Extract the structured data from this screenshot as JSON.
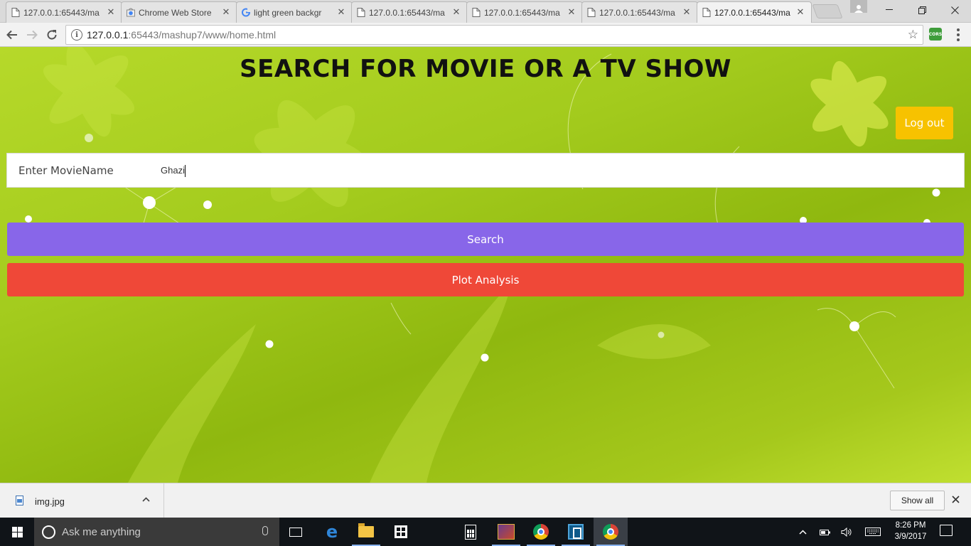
{
  "browser": {
    "tabs": [
      {
        "title": "127.0.0.1:65443/ma",
        "icon": "document-icon",
        "active": false
      },
      {
        "title": "Chrome Web Store",
        "icon": "chrome-web-store-icon",
        "active": false
      },
      {
        "title": "light green backgr",
        "icon": "google-icon",
        "active": false
      },
      {
        "title": "127.0.0.1:65443/ma",
        "icon": "document-icon",
        "active": false
      },
      {
        "title": "127.0.0.1:65443/ma",
        "icon": "document-icon",
        "active": false
      },
      {
        "title": "127.0.0.1:65443/ma",
        "icon": "document-icon",
        "active": false
      },
      {
        "title": "127.0.0.1:65443/ma",
        "icon": "document-icon",
        "active": true
      }
    ],
    "url_host": "127.0.0.1",
    "url_rest": ":65443/mashup7/www/home.html",
    "extension_label": "CORS"
  },
  "page": {
    "heading": "SEARCH FOR MOVIE OR A TV SHOW",
    "logout_label": "Log out",
    "search_label": "Enter MovieName",
    "search_value": "Ghazi",
    "search_button": "Search",
    "plot_button": "Plot Analysis",
    "colors": {
      "logout": "#f7c200",
      "search_button": "#8866e9",
      "plot_button": "#ef4838",
      "background": "#a3cb1d"
    }
  },
  "downloads": {
    "file_name": "img.jpg",
    "show_all": "Show all"
  },
  "taskbar": {
    "search_placeholder": "Ask me anything",
    "time": "8:26 PM",
    "date": "3/9/2017",
    "pinned": [
      "task-view-icon",
      "edge-icon",
      "file-explorer-icon",
      "store-icon",
      "calculator-icon",
      "game-icon",
      "chrome-icon",
      "app-icon",
      "chrome-icon"
    ]
  }
}
